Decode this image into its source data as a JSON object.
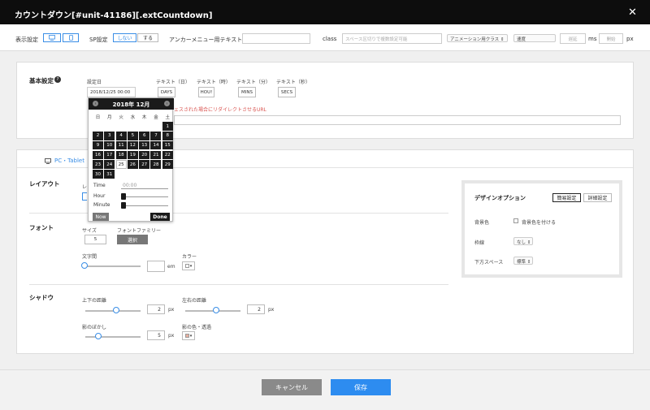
{
  "window": {
    "title": "カウントダウン[#unit-41186][.extCountdown]",
    "close_glyph": "✕"
  },
  "toolbar": {
    "display_label": "表示設定",
    "sp_label": "SP設定",
    "sp_off": "しない",
    "sp_on": "する",
    "anchor_label": "アンカーメニュー用テキスト",
    "anchor_value": "",
    "class_label": "class",
    "class_placeholder": "スペース区切りで複数設定可能",
    "anim_class": "アニメーション用クラス",
    "speed": "速度",
    "delay_placeholder": "遅延",
    "ms_label": "ms",
    "start_placeholder": "開始",
    "px_label": "px"
  },
  "basic": {
    "title": "基本設定",
    "help_glyph": "?",
    "date_label": "設定日",
    "date_value": "2018/12/25 00:00",
    "text_day_label": "テキスト（日）",
    "text_day_value": "DAYS",
    "text_hour_label": "テキスト（時）",
    "text_hour_value": "HOU!",
    "text_min_label": "テキスト（分）",
    "text_min_value": "MINS",
    "text_sec_label": "テキスト（秒）",
    "text_sec_value": "SECS",
    "redirect_note": "ェスされた場合にリダイレクトさせるURL",
    "redirect_value": ""
  },
  "calendar": {
    "title": "2018年 12月",
    "prev": "‹",
    "next": "›",
    "weekdays": [
      "日",
      "月",
      "火",
      "水",
      "木",
      "金",
      "土"
    ],
    "weeks": [
      [
        "",
        "",
        "",
        "",
        "",
        "",
        "1"
      ],
      [
        "2",
        "3",
        "4",
        "5",
        "6",
        "7",
        "8"
      ],
      [
        "9",
        "10",
        "11",
        "12",
        "13",
        "14",
        "15"
      ],
      [
        "16",
        "17",
        "18",
        "19",
        "20",
        "21",
        "22"
      ],
      [
        "23",
        "24",
        "25",
        "26",
        "27",
        "28",
        "29"
      ],
      [
        "30",
        "31",
        "",
        "",
        "",
        "",
        ""
      ]
    ],
    "today": "25",
    "time_label": "Time",
    "time_value": "00:00",
    "hour_label": "Hour",
    "minute_label": "Minute",
    "now_label": "Now",
    "done_label": "Done"
  },
  "tabs": {
    "pc_tablet": "PC・Tablet"
  },
  "layout": {
    "title": "レイアウト",
    "sub_label": "レ"
  },
  "font": {
    "title": "フォント",
    "size_label": "サイズ",
    "size_value": "5",
    "family_label": "フォントファミリー",
    "family_button": "選択",
    "letter_spacing_label": "文字間",
    "letter_spacing_value": "",
    "em_label": "em",
    "color_label": "カラー",
    "color_value": "#ffffff"
  },
  "shadow": {
    "title": "シャドウ",
    "vertical_label": "上下の距離",
    "vertical_value": "2",
    "horizontal_label": "左右の距離",
    "horizontal_value": "2",
    "blur_label": "影のぼかし",
    "blur_value": "5",
    "color_label": "影の色・透過",
    "color_value": "#e8b0a0",
    "px": "px"
  },
  "design_options": {
    "title": "デザインオプション",
    "simple_tab": "簡易設定",
    "detail_tab": "詳細設定",
    "bg_label": "背景色",
    "bg_checkbox": "背景色を付ける",
    "border_label": "枠線",
    "border_value": "なし",
    "bottom_space_label": "下方スペース",
    "bottom_space_value": "標準"
  },
  "footer": {
    "cancel": "キャンセル",
    "save": "保存"
  },
  "colors": {
    "accent": "#3a8ee6",
    "save": "#2d8cf0",
    "cancel": "#8a8a8a",
    "danger_text": "#d9534f"
  }
}
